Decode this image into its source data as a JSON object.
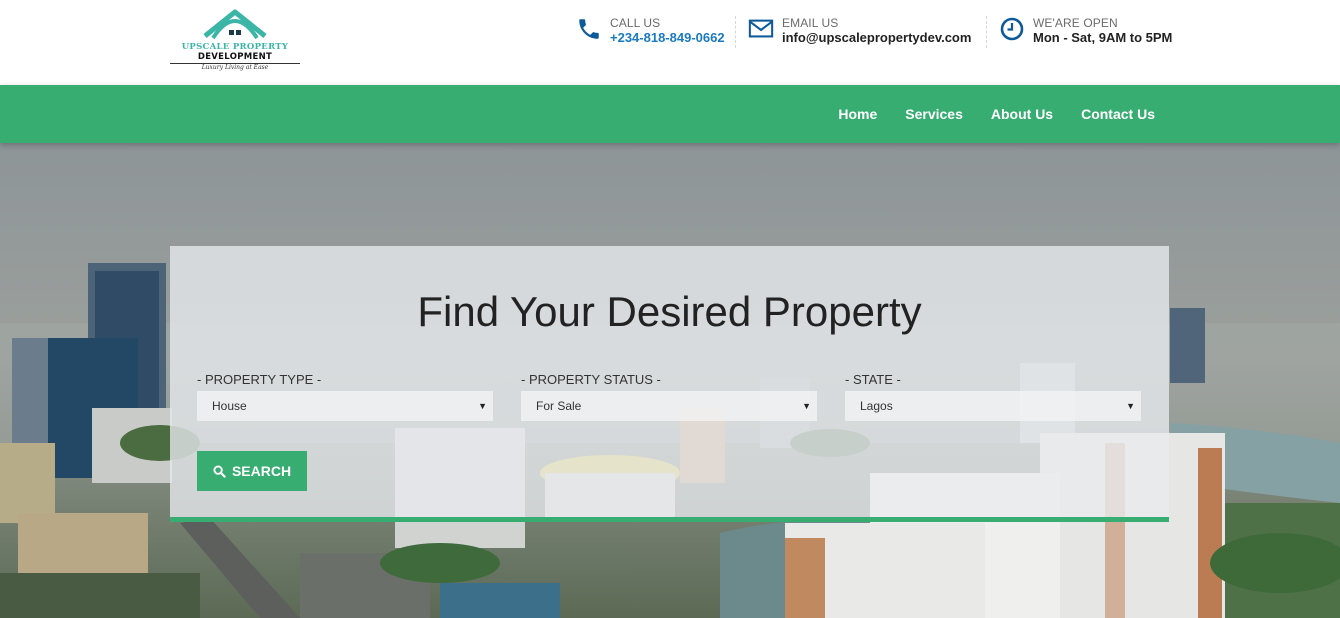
{
  "brand": {
    "name": "UPSCALE PROPERTY",
    "sub": "DEVELOPMENT",
    "tagline": "Luxury Living at Ease"
  },
  "contacts": [
    {
      "icon": "phone-icon",
      "label": "CALL US",
      "value": "+234-818-849-0662"
    },
    {
      "icon": "email-icon",
      "label": "EMAIL US",
      "value": "info@upscalepropertydev.com"
    },
    {
      "icon": "clock-icon",
      "label": "WE'ARE OPEN",
      "value": "Mon - Sat, 9AM to 5PM"
    }
  ],
  "nav": {
    "items": [
      {
        "label": "Home"
      },
      {
        "label": "Services"
      },
      {
        "label": "About Us"
      },
      {
        "label": "Contact Us"
      }
    ]
  },
  "search": {
    "title": "Find Your Desired Property",
    "fields": [
      {
        "label": "- PROPERTY TYPE -",
        "value": "House"
      },
      {
        "label": "- PROPERTY STATUS -",
        "value": "For Sale"
      },
      {
        "label": "- STATE -",
        "value": "Lagos"
      }
    ],
    "button_label": "SEARCH"
  },
  "colors": {
    "brand_green": "#38ad72",
    "phone_blue": "#1a7ac0",
    "logo_teal": "#3ab5a6"
  }
}
